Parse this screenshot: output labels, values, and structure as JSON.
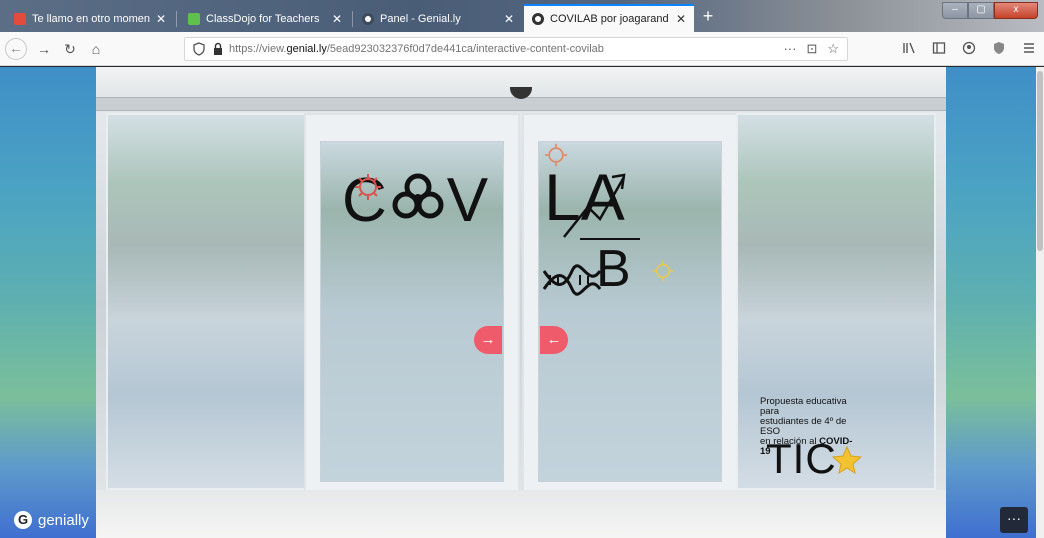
{
  "browser": {
    "tabs": [
      {
        "title": "Te llamo en otro momento - jo",
        "close": "✕"
      },
      {
        "title": "ClassDojo for Teachers",
        "close": "✕"
      },
      {
        "title": "Panel - Genial.ly",
        "close": "✕"
      },
      {
        "title": "COVILAB por joagarand en Gen",
        "close": "✕",
        "active": true
      }
    ],
    "new_tab": "+",
    "url_prefix": "https://view.",
    "url_domain": "genial.ly",
    "url_path": "/5ead92303237​6f0d7de441ca/interactive-content-covilab",
    "url_actions": {
      "more": "···",
      "pocket": "⊡",
      "bookmark": "☆"
    },
    "window_controls": {
      "minimize": "–",
      "maximize": "▢",
      "close": "x"
    }
  },
  "nav": {
    "back": "←",
    "forward": "→",
    "reload": "↻",
    "home": "⌂"
  },
  "page": {
    "title_left": "CO:V",
    "title_cov_c": "C",
    "title_cov_v": "V",
    "title_la": "LA",
    "title_b": "B",
    "arrow_right": "→",
    "arrow_left": "←",
    "proposal_line1": "Propuesta educativa para",
    "proposal_line2": "estudiantes de 4º de ESO",
    "proposal_line3": "en relación al ",
    "proposal_bold": "COVID-19",
    "tic": "TIC",
    "brand": "genially",
    "more": "···"
  },
  "colors": {
    "accent_arrow": "#ef5b6a",
    "star": "#f2c230",
    "tab_active_border": "#0a84ff"
  }
}
